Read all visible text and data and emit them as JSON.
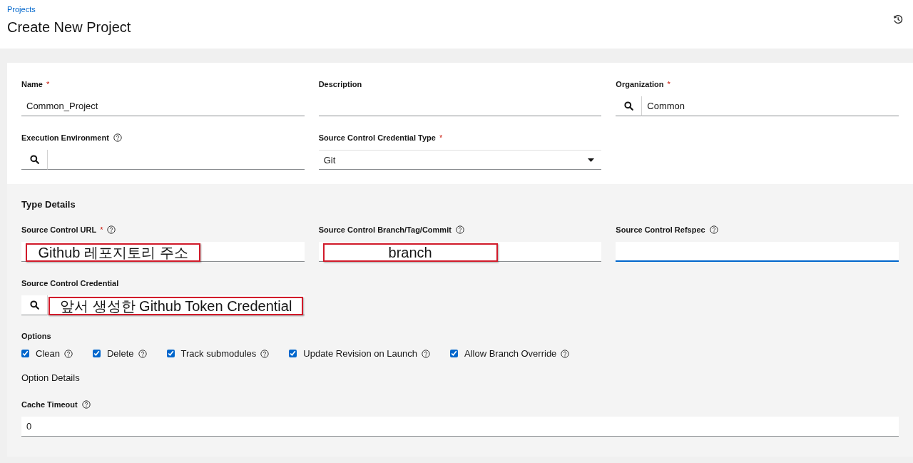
{
  "breadcrumb": "Projects",
  "title": "Create New Project",
  "main_fields": [
    {
      "label": "Name",
      "required_mark": "*",
      "kind": "text",
      "value": "Common_Project"
    },
    {
      "label": "Description",
      "kind": "text"
    },
    {
      "label": "Organization",
      "required_mark": "*",
      "kind": "lookup",
      "value": "Common"
    },
    {
      "label": "Execution Environment",
      "help": true,
      "kind": "lookup"
    },
    {
      "label": "Source Control Credential Type",
      "required_mark": "*",
      "kind": "select",
      "value": "Git"
    }
  ],
  "type_details": {
    "heading": "Type Details",
    "fields": [
      {
        "label": "Source Control URL",
        "required_mark": "*",
        "help": true,
        "kind": "text",
        "annotation": "Github 레포지토리 주소"
      },
      {
        "label": "Source Control Branch/Tag/Commit",
        "help": true,
        "kind": "text",
        "annotation": "branch"
      },
      {
        "label": "Source Control Refspec",
        "help": true,
        "kind": "text",
        "focused": true
      },
      {
        "label": "Source Control Credential",
        "kind": "lookup",
        "annotation": "앞서 생성한 Github Token Credential"
      }
    ]
  },
  "options": {
    "heading": "Options",
    "items": [
      {
        "label": "Clean",
        "checked": true
      },
      {
        "label": "Delete",
        "checked": true
      },
      {
        "label": "Track submodules",
        "checked": true
      },
      {
        "label": "Update Revision on Launch",
        "checked": true
      },
      {
        "label": "Allow Branch Override",
        "checked": true
      }
    ]
  },
  "option_details": {
    "heading": "Option Details",
    "fields": [
      {
        "label": "Cache Timeout",
        "help": true,
        "kind": "text",
        "value": "0"
      }
    ]
  }
}
